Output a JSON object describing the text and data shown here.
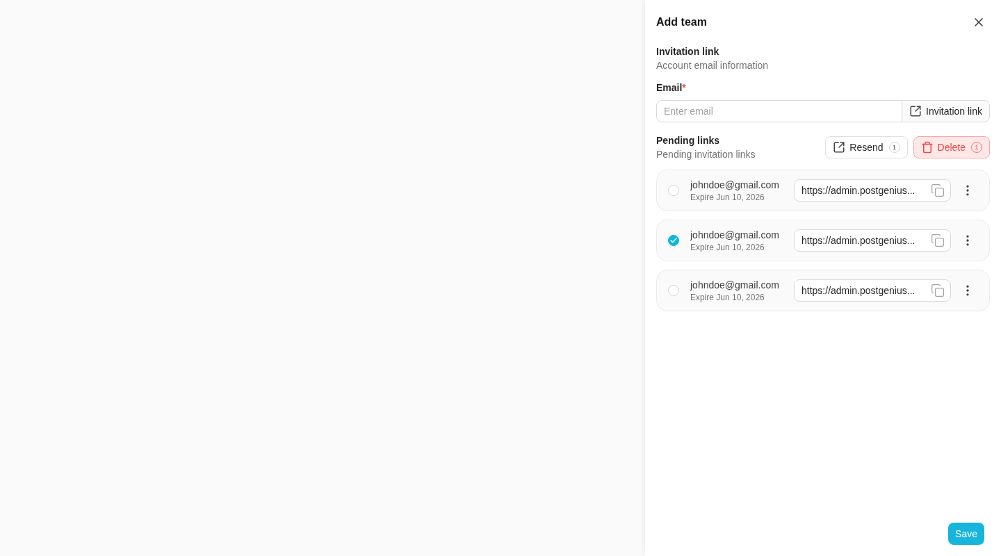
{
  "panel": {
    "title": "Add team"
  },
  "invitation": {
    "title": "Invitation link",
    "subtitle": "Account email information",
    "email_label": "Email",
    "required_mark": "*",
    "email_placeholder": "Enter email",
    "button": "Invitation link"
  },
  "pending": {
    "title": "Pending links",
    "subtitle": "Pending invitation links",
    "actions": [
      {
        "kind": "resend",
        "label": "Resend",
        "count": "1"
      },
      {
        "kind": "delete",
        "label": "Delete",
        "count": "1"
      }
    ],
    "links": [
      {
        "email": "johndoe@gmail.com",
        "expiry": "Expire Jun 10, 2026",
        "url": "https://admin.postgenius...",
        "checked": false
      },
      {
        "email": "johndoe@gmail.com",
        "expiry": "Expire Jun 10, 2026",
        "url": "https://admin.postgenius...",
        "checked": true
      },
      {
        "email": "johndoe@gmail.com",
        "expiry": "Expire Jun 10, 2026",
        "url": "https://admin.postgenius...",
        "checked": false
      }
    ]
  },
  "save_button": "Save"
}
